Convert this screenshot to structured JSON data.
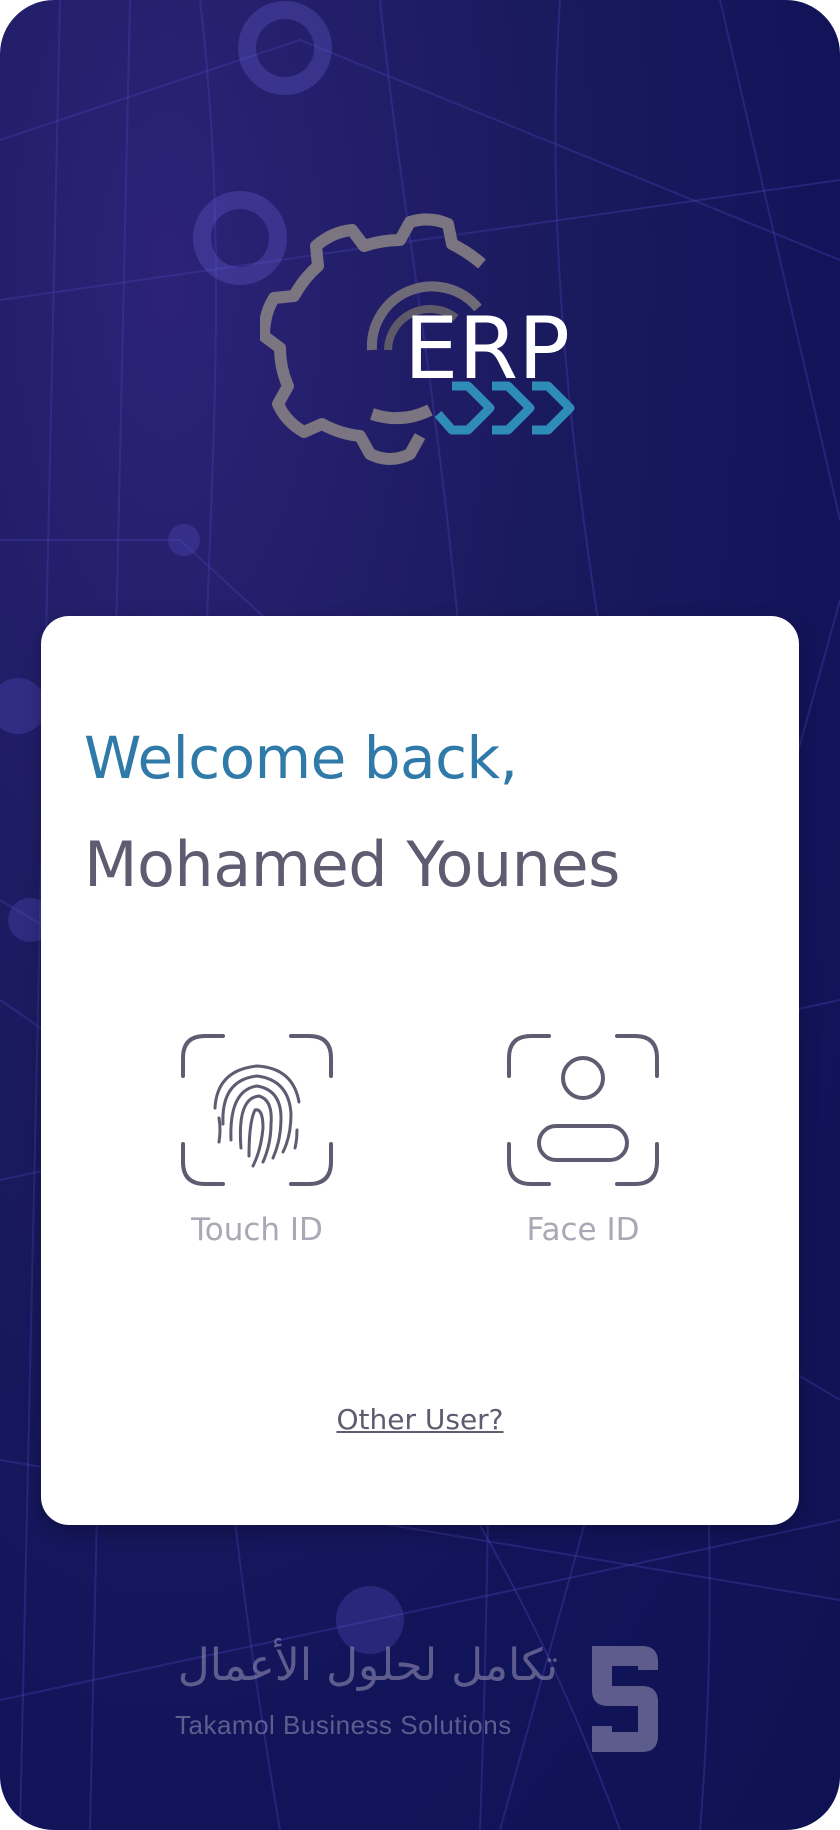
{
  "app": {
    "logo_text": "ERP"
  },
  "login": {
    "greeting": "Welcome back,",
    "user_name": "Mohamed Younes",
    "touch_id_label": "Touch ID",
    "face_id_label": "Face ID",
    "other_user_link": "Other User?"
  },
  "footer": {
    "company_arabic": "تكامل لحلول الأعمال",
    "company_english": "Takamol Business Solutions"
  },
  "icons": {
    "logo": "gear-erp-logo-icon",
    "touch": "fingerprint-icon",
    "face": "face-id-icon",
    "brand": "takamol-logo-icon"
  },
  "colors": {
    "background": "#1a1a5e",
    "accent": "#2f7aa8",
    "text_dark": "#5f5b70",
    "text_muted": "#a9a8b4",
    "logo_gear": "#7a7580"
  }
}
